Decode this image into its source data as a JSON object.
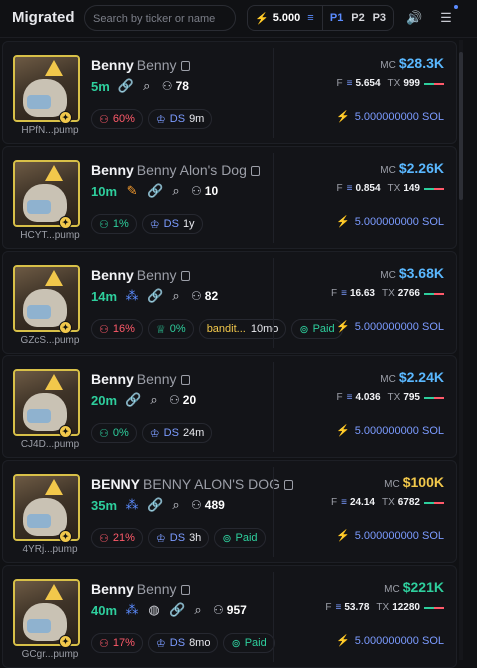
{
  "header": {
    "title": "Migrated",
    "search_placeholder": "Search by ticker or name",
    "sol_amount": "5.000",
    "presets": [
      "P1",
      "P2",
      "P3"
    ],
    "active_preset": "P1"
  },
  "colors": {
    "accent": "#5b8cff",
    "green": "#2ecf9d",
    "red": "#ff5a6a",
    "gold": "#f2c84b",
    "mc_blue": "#5ab8ff"
  },
  "tokens": [
    {
      "name": "Benny",
      "subname": "Benny",
      "age": "5m",
      "icons": [
        "link-icon",
        "search-icon"
      ],
      "holders": "78",
      "ticker": "HPfN...pump",
      "chips": [
        {
          "type": "red",
          "label": "60%",
          "icon": "user-icon"
        },
        {
          "type": "ds",
          "label": "DS",
          "value": "9m"
        }
      ],
      "mc": "$28.3K",
      "mc_color": "blue",
      "fees": "5.654",
      "tx": "999",
      "sol": "5.000000000 SOL"
    },
    {
      "name": "Benny",
      "subname": "Benny Alon's Dog",
      "age": "10m",
      "icons": [
        "pen-icon",
        "link-icon",
        "search-icon"
      ],
      "holders": "10",
      "ticker": "HCYT...pump",
      "chips": [
        {
          "type": "green",
          "label": "1%",
          "icon": "user-icon"
        },
        {
          "type": "ds",
          "label": "DS",
          "value": "1y"
        }
      ],
      "mc": "$2.26K",
      "mc_color": "blue",
      "fees": "0.854",
      "tx": "149",
      "sol": "5.000000000 SOL"
    },
    {
      "name": "Benny",
      "subname": "Benny",
      "age": "14m",
      "icons": [
        "users-group-icon",
        "link-icon",
        "search-icon"
      ],
      "holders": "82",
      "ticker": "GZcS...pump",
      "chips": [
        {
          "type": "red",
          "label": "16%",
          "icon": "user-icon"
        },
        {
          "type": "plain",
          "label": "0%",
          "icon": "crown-icon"
        },
        {
          "type": "bandit",
          "label": "bandit...",
          "value": "10mo"
        },
        {
          "type": "paid",
          "label": "Paid"
        }
      ],
      "mc": "$3.68K",
      "mc_color": "blue",
      "fees": "16.63",
      "tx": "2766",
      "sol": "5.000000000 SOL"
    },
    {
      "name": "Benny",
      "subname": "Benny",
      "age": "20m",
      "icons": [
        "link-icon",
        "search-icon"
      ],
      "holders": "20",
      "ticker": "CJ4D...pump",
      "chips": [
        {
          "type": "green",
          "label": "0%",
          "icon": "user-icon"
        },
        {
          "type": "ds",
          "label": "DS",
          "value": "24m"
        }
      ],
      "mc": "$2.24K",
      "mc_color": "blue",
      "fees": "4.036",
      "tx": "795",
      "sol": "5.000000000 SOL"
    },
    {
      "name": "BENNY",
      "subname": "BENNY ALON'S DOG",
      "age": "35m",
      "icons": [
        "users-group-icon",
        "link-icon",
        "search-icon"
      ],
      "holders": "489",
      "ticker": "4YRj...pump",
      "chips": [
        {
          "type": "red",
          "label": "21%",
          "icon": "user-icon"
        },
        {
          "type": "ds",
          "label": "DS",
          "value": "3h"
        },
        {
          "type": "paid",
          "label": "Paid"
        }
      ],
      "mc": "$100K",
      "mc_color": "gold",
      "fees": "24.14",
      "tx": "6782",
      "sol": "5.000000000 SOL"
    },
    {
      "name": "Benny",
      "subname": "Benny",
      "age": "40m",
      "icons": [
        "users-group-icon",
        "globe-icon",
        "link-icon",
        "search-icon"
      ],
      "holders": "957",
      "ticker": "GCgr...pump",
      "chips": [
        {
          "type": "red",
          "label": "17%",
          "icon": "user-icon"
        },
        {
          "type": "ds",
          "label": "DS",
          "value": "8mo"
        },
        {
          "type": "paid",
          "label": "Paid"
        }
      ],
      "mc": "$221K",
      "mc_color": "green",
      "fees": "53.78",
      "tx": "12280",
      "sol": "5.000000000 SOL"
    }
  ],
  "labels": {
    "mc": "MC",
    "fees": "F",
    "tx": "TX"
  }
}
